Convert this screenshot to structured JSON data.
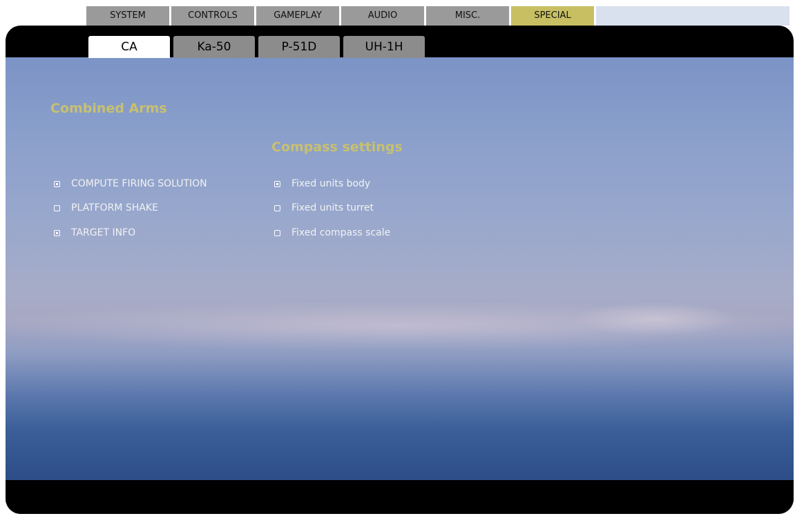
{
  "top_tabs": [
    {
      "label": "SYSTEM",
      "active": false
    },
    {
      "label": "CONTROLS",
      "active": false
    },
    {
      "label": "GAMEPLAY",
      "active": false
    },
    {
      "label": "AUDIO",
      "active": false
    },
    {
      "label": "MISC.",
      "active": false
    },
    {
      "label": "SPECIAL",
      "active": true
    }
  ],
  "module_tabs": [
    {
      "label": "CA",
      "active": true
    },
    {
      "label": "Ka-50",
      "active": false
    },
    {
      "label": "P-51D",
      "active": false
    },
    {
      "label": "UH-1H",
      "active": false
    }
  ],
  "section": {
    "title": "Combined Arms"
  },
  "compass": {
    "title": "Compass settings"
  },
  "left_options": [
    {
      "label": "COMPUTE FIRING SOLUTION",
      "checked": true
    },
    {
      "label": "PLATFORM SHAKE",
      "checked": false
    },
    {
      "label": "TARGET INFO",
      "checked": true
    }
  ],
  "right_options": [
    {
      "label": "Fixed units body",
      "checked": true
    },
    {
      "label": "Fixed units turret",
      "checked": false
    },
    {
      "label": "Fixed compass scale",
      "checked": false
    }
  ],
  "colors": {
    "accent": "#c8bf63",
    "heading": "#c8c070"
  }
}
